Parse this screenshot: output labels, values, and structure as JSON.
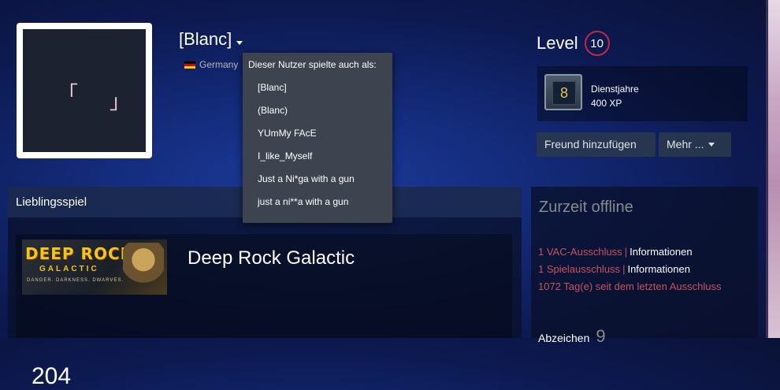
{
  "profile": {
    "persona_name": "[Blanc]",
    "country": "Germany",
    "avatar_glyphs": {
      "left": "「",
      "right": "」"
    }
  },
  "aliases_dropdown": {
    "title": "Dieser Nutzer spielte auch als:",
    "items": [
      "[Blanc]",
      "(Blanc)",
      "YUmMy FAcE",
      "I_like_Myself",
      "Just a Ni*ga with a gun",
      "just a ni**a with a gun"
    ]
  },
  "level": {
    "label": "Level",
    "value": "10"
  },
  "years_badge": {
    "icon_value": "8",
    "title": "Dienstjahre",
    "xp": "400 XP"
  },
  "buttons": {
    "add_friend": "Freund hinzufügen",
    "more": "Mehr ..."
  },
  "favorite_game": {
    "section_title": "Lieblingsspiel",
    "game_name": "Deep Rock Galactic",
    "logo_line1": "DEEP ROCK",
    "logo_line2": "GALACTIC",
    "logo_line3": "DANGER. DARKNESS. DWARVES.",
    "hours_value": "204"
  },
  "status": {
    "title": "Zurzeit offline",
    "vac_ban": "1 VAC-Ausschluss",
    "game_ban": "1 Spielausschluss",
    "info_label": "Informationen",
    "days_since": "1072 Tag(e) seit dem letzten Ausschluss",
    "badges_label": "Abzeichen",
    "badges_count": "9"
  },
  "colors": {
    "accent_red": "#c6535e",
    "level_ring": "#c02942",
    "background": "#132a78"
  }
}
